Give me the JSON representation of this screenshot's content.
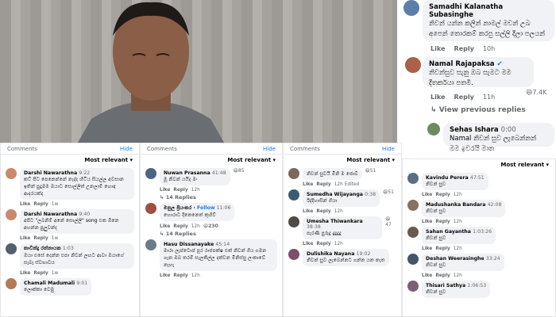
{
  "right_top": {
    "c1": {
      "name": "Samadhi Kalanatha Subasinghe",
      "text": "නිවන් යන්න කලින් නාමල් මචන් උබ අපෙන් තොරකම් කරපු සල්ලි දීලා පලයන්",
      "like": "Like",
      "reply": "Reply",
      "time": "10h"
    },
    "c2": {
      "name": "Namal Rajapaksa",
      "text": "නිවන්සුව සැනු ඔබ සැමට මම දීතර්කයා පතමි.",
      "like": "Like",
      "reply": "Reply",
      "time": "11h",
      "reactions": "7.4K"
    },
    "view_prev": "View previous replies",
    "c3": {
      "name": "Sehas Ishara",
      "time": "0:00",
      "text": "Namal නිවන් සුව ලැබෙන්නන් මම ඉවරයි මාත"
    }
  },
  "panel1": {
    "title": "Comments",
    "hide": "Hide",
    "relevant": "Most relevant",
    "comments": [
      {
        "name": "Darshi Nawarathna",
        "time": "9:22",
        "text": "කට් පිට පෙනෙන්නේ නැද්ද හිටිය සියල්ල අවසාන ඉතින් පුදුමම ඔයාට සොල්ලිත් උනලාම් හොඳ ආදරයක්ද",
        "like": "Like",
        "reply": "Reply",
        "rtime": "1w"
      },
      {
        "name": "Darshi Nawarathna",
        "time": "9:40",
        "text": "අපිට \"ලබනිම් අනේ සොල්ලි\" song එක ඕනෙ අහන්න පුලුවන්ද",
        "like": "Like",
        "reply": "Reply",
        "rtime": "1w"
      },
      {
        "name": "කාවින්දු රත්නායක",
        "time": "1:03",
        "text": "ඔයා එසේ දෙන්න එපා නිවන් ලඟට ආවා ඔයාගේ සැබෑ ස්වභාවය",
        "like": "Like",
        "reply": "Reply",
        "rtime": "1w"
      },
      {
        "name": "Chamali Madumali",
        "time": "9:01",
        "text": "ලොක්කා වෙමු",
        "like": "Like",
        "reply": "Reply",
        "rtime": "1w"
      }
    ]
  },
  "panel2": {
    "title": "Comments",
    "hide": "Hide",
    "relevant": "Most relevant",
    "comments": [
      {
        "name": "Nuwan Prasanna",
        "time": "41:48",
        "text": "මූ නිවන් යයිද මං",
        "reactions": "85",
        "like": "Like",
        "reply": "Reply",
        "rtime": "12h",
        "replies": "14 Replies"
      },
      {
        "name": "මනුල ප්‍රියංකර",
        "follow": "Follow",
        "time": "11:06",
        "text": "හොරාට දිනෙනෙත් කුහිව්",
        "reactions": "230",
        "like": "Like",
        "reply": "Reply",
        "rtime": "12h",
        "replies": "14 Replies"
      },
      {
        "name": "Hasu Dissanayake",
        "time": "45:14",
        "text": "මාරා ලැප්ටොප් පූර රාජපක්ෂ එක් නිවන් ගිය ගමන ගැන ඔබ තරම් සැලකිල්ල දක්වන මිනිස්සු ලංකාවේ නැහැ",
        "like": "Like",
        "reply": "Reply",
        "rtime": "12h"
      }
    ]
  },
  "panel3": {
    "title": "Comments",
    "hide": "Hide",
    "relevant": "Most relevant",
    "comments": [
      {
        "name": "",
        "text": "නිවන් සුවයි මිනි ම ජොබ්",
        "reactions": "51",
        "like": "Like",
        "reply": "Reply",
        "rtime": "12h",
        "edited": "Edited"
      },
      {
        "name": "Sumedha Wijayanga",
        "time": "0:38",
        "text": "ඊද්දිහාසින් ගියා",
        "reactions": "51",
        "like": "Like",
        "reply": "Reply",
        "rtime": "12h"
      },
      {
        "name": "Umesha Thiwankara",
        "time": "38:38",
        "text": "පැරණි පුරුදු දුදුදුදු",
        "reactions": "47",
        "like": "Like",
        "reply": "Reply",
        "rtime": "12h"
      },
      {
        "name": "Dulishika Nayana",
        "time": "19:02",
        "text": "නිවන් සුව ලැබෙන්නට ගන්න යන නැත",
        "like": "Like",
        "reply": "Reply",
        "rtime": "12h"
      }
    ]
  },
  "panel4": {
    "relevant": "Most relevant",
    "comments": [
      {
        "name": "Kavindu Perera",
        "time": "47:51",
        "text": "නිවන් සුව",
        "like": "Like",
        "reply": "Reply",
        "rtime": "12h"
      },
      {
        "name": "Madushanka Bandara",
        "time": "42:08",
        "text": "නිවන් සුව",
        "like": "Like",
        "reply": "Reply",
        "rtime": "12h"
      },
      {
        "name": "Sahan Gayantha",
        "time": "1:03:26",
        "text": "නිවන් සුව",
        "like": "Like",
        "reply": "Reply",
        "rtime": "12h"
      },
      {
        "name": "Deshan Weerasinghe",
        "time": "33:24",
        "text": "නිවන් සුව",
        "like": "Like",
        "reply": "Reply",
        "rtime": "12h"
      },
      {
        "name": "Thisari Sathya",
        "time": "1:06:53",
        "text": "නිවන් සුව",
        "like": "Like",
        "reply": "Reply",
        "rtime": "12h"
      }
    ]
  }
}
